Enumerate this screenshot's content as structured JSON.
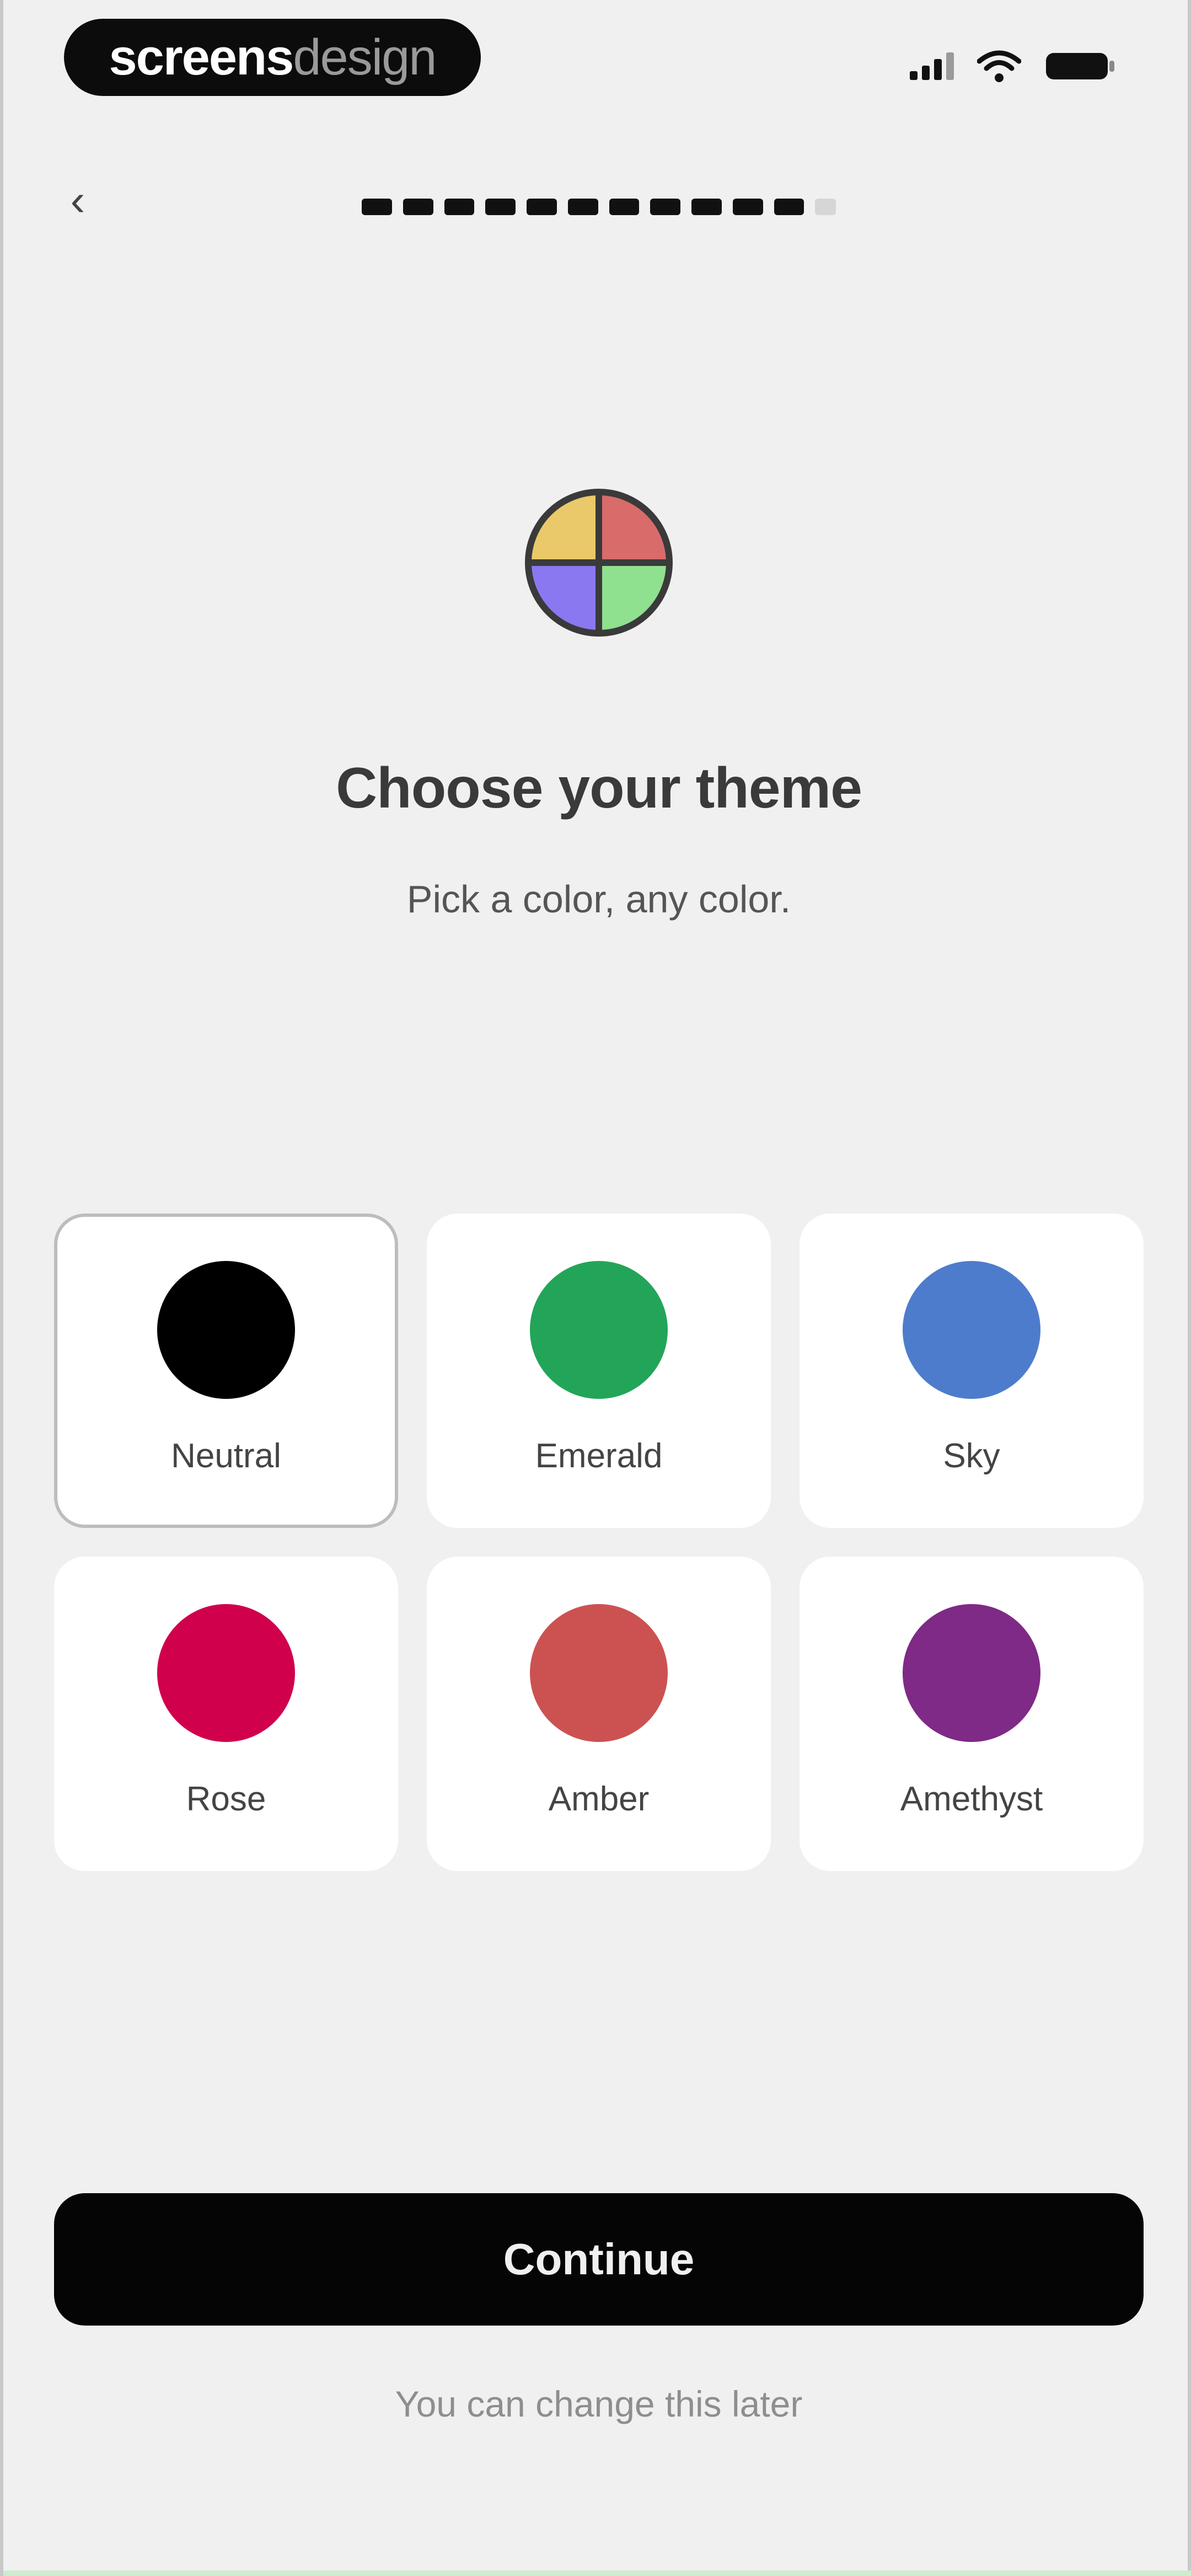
{
  "status_bar": {
    "brand_strong": "screens",
    "brand_light": "design",
    "signal_icon": "cellular-signal-icon",
    "wifi_icon": "wifi-icon",
    "battery_icon": "battery-icon"
  },
  "nav": {
    "back_icon": "chevron-left-icon",
    "back_glyph": "‹",
    "progress": {
      "completed_steps": 11,
      "total_steps": 12
    }
  },
  "hero": {
    "icon": "color-wheel-icon",
    "title": "Choose your theme",
    "subtitle": "Pick a color, any color."
  },
  "themes": [
    {
      "label": "Neutral",
      "color": "#000000",
      "selected": true
    },
    {
      "label": "Emerald",
      "color": "#22a559",
      "selected": false
    },
    {
      "label": "Sky",
      "color": "#4e7ccc",
      "selected": false
    },
    {
      "label": "Rose",
      "color": "#d0004d",
      "selected": false
    },
    {
      "label": "Amber",
      "color": "#cc5252",
      "selected": false
    },
    {
      "label": "Amethyst",
      "color": "#7e2a86",
      "selected": false
    }
  ],
  "footer": {
    "continue_label": "Continue",
    "hint": "You can change this later"
  }
}
